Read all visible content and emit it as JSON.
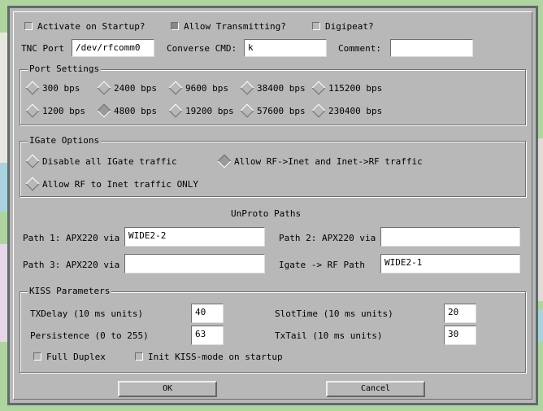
{
  "window": {
    "checkboxes": [
      {
        "label": "Activate on Startup?",
        "checked": false
      },
      {
        "label": "Allow Transmitting?",
        "checked": true
      },
      {
        "label": "Digipeat?",
        "checked": false
      }
    ],
    "tnc_port": {
      "label": "TNC Port",
      "value": "/dev/rfcomm0"
    },
    "converse_cmd": {
      "label": "Converse CMD:",
      "value": "k"
    },
    "comment": {
      "label": "Comment:",
      "value": ""
    }
  },
  "port_settings": {
    "title": "Port Settings",
    "selected": "4800 bps",
    "options": [
      "300 bps",
      "2400 bps",
      "9600 bps",
      "38400 bps",
      "115200 bps",
      "1200 bps",
      "4800 bps",
      "19200 bps",
      "57600 bps",
      "230400 bps"
    ]
  },
  "igate_options": {
    "title": "IGate Options",
    "selected": "Allow RF->Inet and Inet->RF traffic",
    "options": [
      "Disable all IGate traffic",
      "Allow RF->Inet and Inet->RF traffic",
      "Allow RF to Inet traffic ONLY"
    ]
  },
  "unproto": {
    "title": "UnProto Paths",
    "path1": {
      "label": "Path 1: APX220 via",
      "value": "WIDE2-2"
    },
    "path2": {
      "label": "Path 2: APX220 via",
      "value": ""
    },
    "path3": {
      "label": "Path 3: APX220 via",
      "value": ""
    },
    "igate_rf": {
      "label": "Igate -> RF Path",
      "value": "WIDE2-1"
    }
  },
  "kiss": {
    "title": "KISS Parameters",
    "txdelay": {
      "label": "TXDelay (10 ms units)",
      "value": "40"
    },
    "persistence": {
      "label": "Persistence (0 to 255)",
      "value": "63"
    },
    "slottime": {
      "label": "SlotTime (10 ms units)",
      "value": "20"
    },
    "txtail": {
      "label": "TxTail (10 ms units)",
      "value": "30"
    },
    "full_duplex": {
      "label": "Full Duplex",
      "checked": false
    },
    "init_kiss": {
      "label": "Init KISS-mode on startup",
      "checked": false
    }
  },
  "buttons": {
    "ok": "OK",
    "cancel": "Cancel"
  }
}
